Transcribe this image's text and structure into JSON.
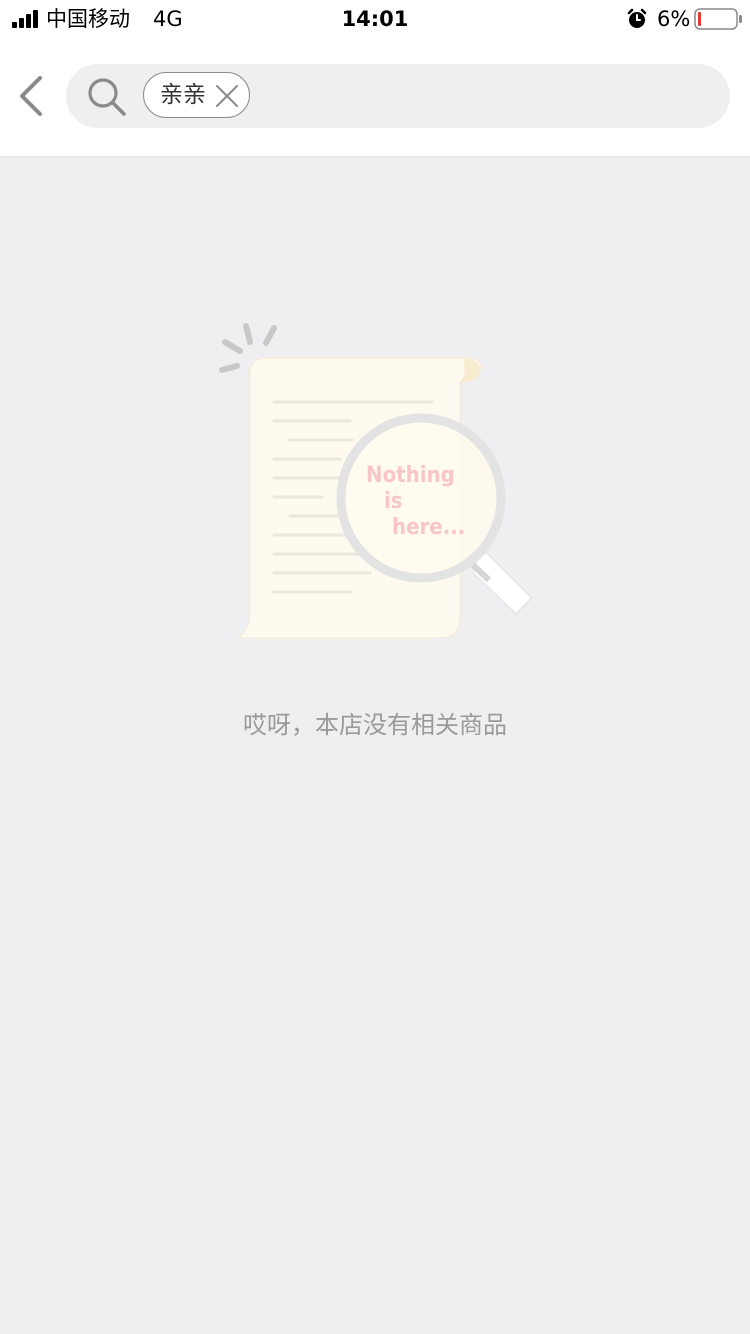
{
  "status_bar": {
    "carrier": "中国移动",
    "network": "4G",
    "time": "14:01",
    "battery_percent": "6%",
    "battery_level": 0.06
  },
  "header": {
    "back_icon": "chevron-left-icon",
    "search_icon": "search-icon",
    "search_tag": {
      "label": "亲亲",
      "close_icon": "close-icon"
    }
  },
  "empty_state": {
    "illustration_text": [
      "Nothing",
      "is",
      "here..."
    ],
    "message": "哎呀，本店没有相关商品"
  },
  "colors": {
    "background": "#efeff1",
    "header_bg": "#ffffff",
    "search_bg": "#efefef",
    "message_text": "#9a9a9a",
    "battery_low": "#e53935"
  }
}
